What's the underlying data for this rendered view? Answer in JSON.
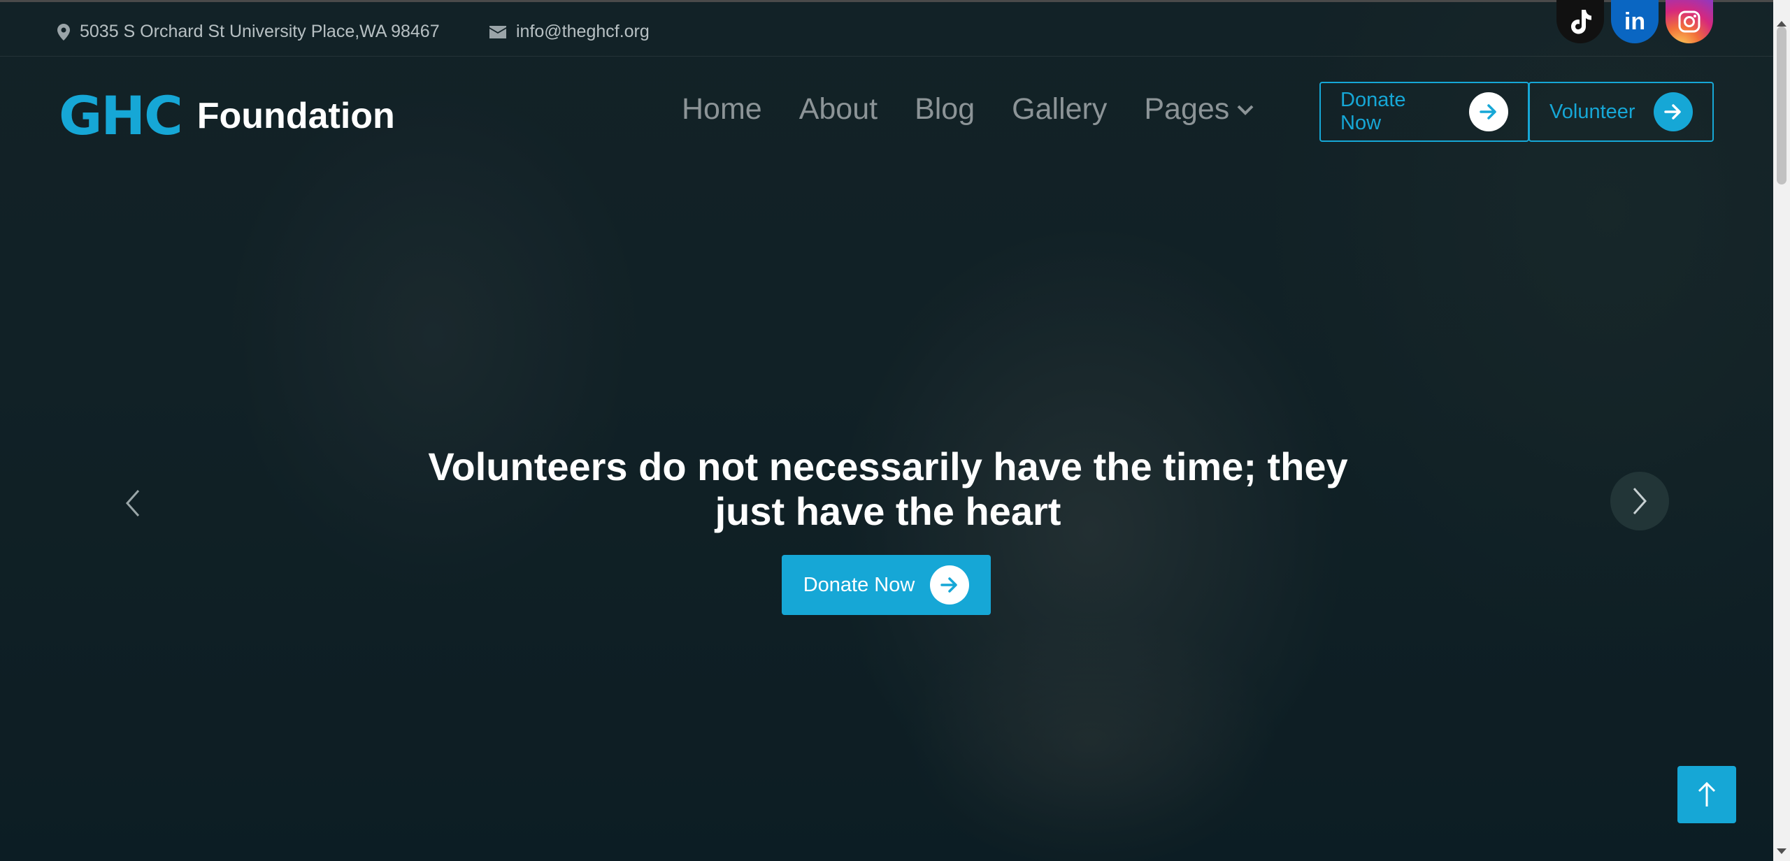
{
  "topbar": {
    "address": "5035 S Orchard St University Place,WA 98467",
    "email": "info@theghcf.org",
    "social_icons": [
      "tiktok-icon",
      "linkedin-icon",
      "instagram-icon"
    ]
  },
  "header": {
    "logo_mark": "GHC",
    "logo_text": "Foundation",
    "nav": [
      "Home",
      "About",
      "Blog",
      "Gallery",
      "Pages"
    ],
    "donate_label": "Donate Now",
    "volunteer_label": "Volunteer"
  },
  "hero": {
    "headline_line1": "Volunteers do not necessarily have the time; they",
    "headline_line2": "just have the heart",
    "cta_label": "Donate Now"
  },
  "colors": {
    "accent": "#16a7d6",
    "nav_text": "#8c9497",
    "linkedin": "#0a66c2"
  }
}
